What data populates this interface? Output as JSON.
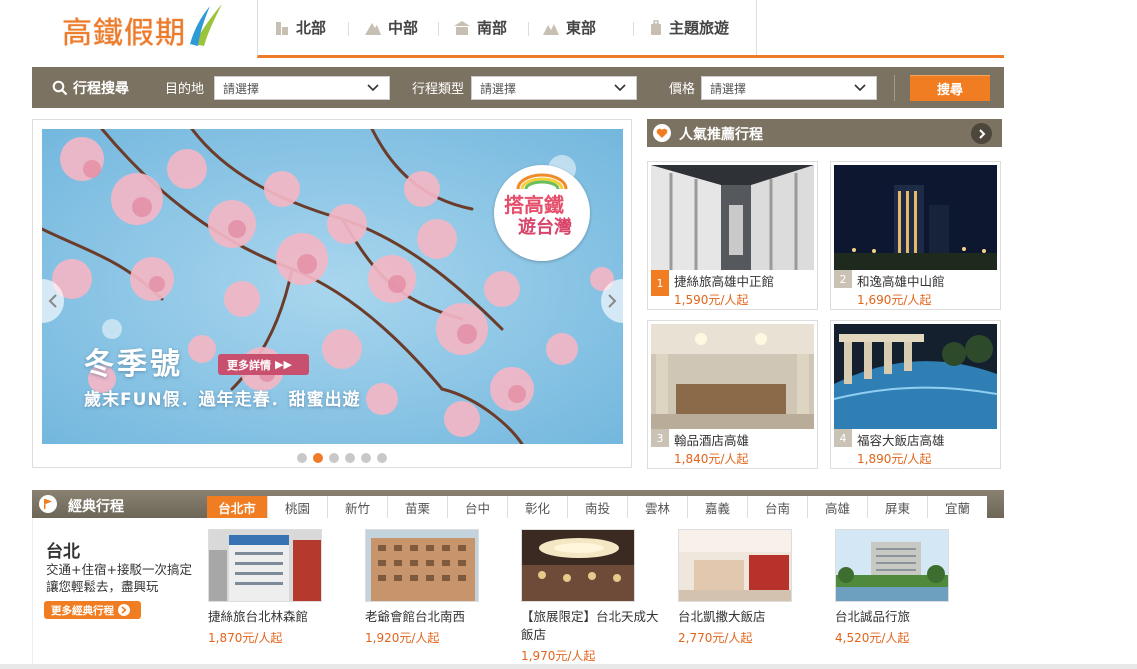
{
  "header": {
    "logo_text": "高鐵假期",
    "nav": [
      {
        "label": "北部",
        "icon": "building-icon"
      },
      {
        "label": "中部",
        "icon": "mountain-icon"
      },
      {
        "label": "南部",
        "icon": "temple-icon"
      },
      {
        "label": "東部",
        "icon": "landscape-icon"
      },
      {
        "label": "主題旅遊",
        "icon": "luggage-icon"
      }
    ]
  },
  "search": {
    "label": "行程搜尋",
    "destination_label": "目的地",
    "destination_value": "請選擇",
    "type_label": "行程類型",
    "type_value": "請選擇",
    "price_label": "價格",
    "price_value": "請選擇",
    "button": "搜尋"
  },
  "banner": {
    "badge_line1": "搭高鐵",
    "badge_line2": "遊台灣",
    "title": "冬季號",
    "more": "更多詳情",
    "subtitle": "歲末FUN假．過年走春．甜蜜出遊",
    "slide_count": 6,
    "active_slide": 2
  },
  "popular": {
    "title": "人氣推薦行程",
    "items": [
      {
        "rank": "1",
        "name": "捷絲旅高雄中正館",
        "price": "1,590元/人起"
      },
      {
        "rank": "2",
        "name": "和逸高雄中山館",
        "price": "1,690元/人起"
      },
      {
        "rank": "3",
        "name": "翰品酒店高雄",
        "price": "1,840元/人起"
      },
      {
        "rank": "4",
        "name": "福容大飯店高雄",
        "price": "1,890元/人起"
      }
    ]
  },
  "classic": {
    "title": "經典行程",
    "tabs": [
      "台北市",
      "桃園",
      "新竹",
      "苗栗",
      "台中",
      "彰化",
      "南投",
      "雲林",
      "嘉義",
      "台南",
      "高雄",
      "屏東",
      "宜蘭"
    ],
    "active_tab": "台北市",
    "city": "台北",
    "desc_line1": "交通+住宿+接駁一次搞定",
    "desc_line2": "讓您輕鬆去，盡興玩",
    "more": "更多經典行程",
    "items": [
      {
        "name": "捷絲旅台北林森館",
        "price": "1,870元/人起"
      },
      {
        "name": "老爺會館台北南西",
        "price": "1,920元/人起"
      },
      {
        "name": "【旅展限定】台北天成大飯店",
        "price": "1,970元/人起"
      },
      {
        "name": "台北凱撒大飯店",
        "price": "2,770元/人起"
      },
      {
        "name": "台北誠品行旅",
        "price": "4,520元/人起"
      }
    ]
  },
  "colors": {
    "accent": "#f07d22",
    "bar": "#7b7261",
    "price": "#e2641a"
  }
}
